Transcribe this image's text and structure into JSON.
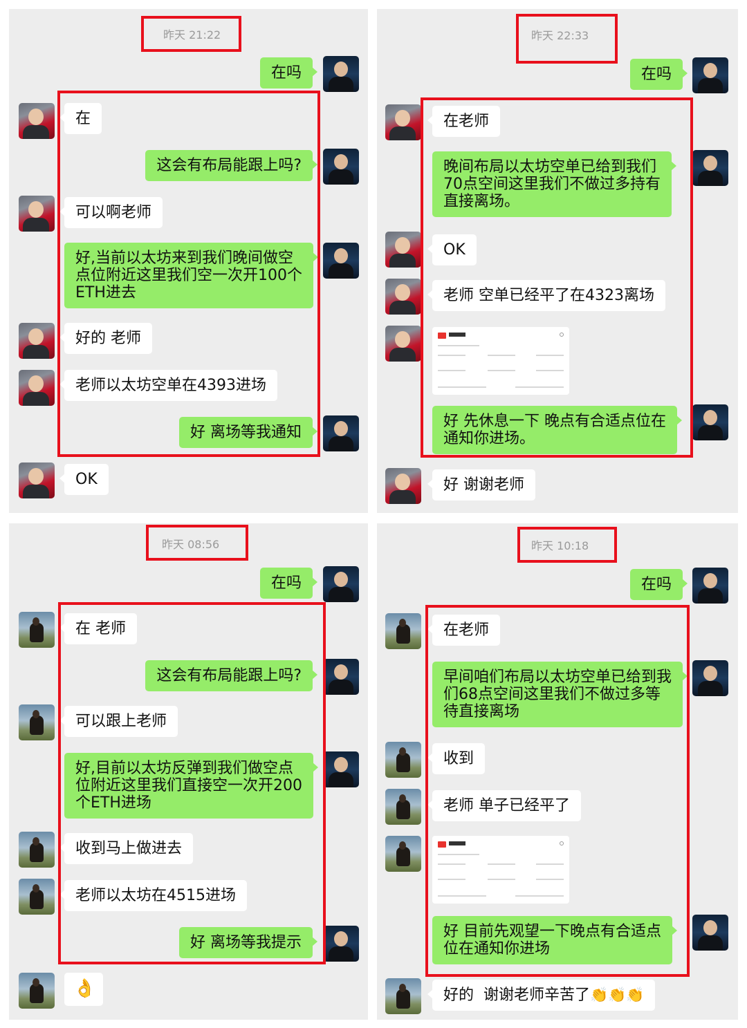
{
  "panels": [
    {
      "timestamp": "昨天 21:22",
      "messages": [
        "在吗",
        "在",
        "这会有布局能跟上吗?",
        "可以啊老师",
        "好,当前以太坊来到我们晚间做空\n点位附近这里我们空一次开100个\nETH进去",
        "好的 老师",
        "老师以太坊空单在4393进场",
        "好 离场等我通知",
        "OK"
      ]
    },
    {
      "timestamp": "昨天 22:33",
      "messages": [
        "在吗",
        "在老师",
        "晚间布局以太坊空单已给到我们\n70点空间这里我们不做过多持有\n直接离场。",
        "OK",
        "老师 空单已经平了在4323离场",
        "好 先休息一下 晚点有合适点位在\n通知你进场。",
        "好 谢谢老师"
      ]
    },
    {
      "timestamp": "昨天 08:56",
      "messages": [
        "在吗",
        "在 老师",
        "这会有布局能跟上吗?",
        "可以跟上老师",
        "好,目前以太坊反弹到我们做空点\n位附近这里我们直接空一次开200\n个ETH进场",
        "收到马上做进去",
        "老师以太坊在4515进场",
        "好 离场等我提示"
      ]
    },
    {
      "timestamp": "昨天 10:18",
      "messages": [
        "在吗",
        "在老师",
        "早间咱们布局以太坊空单已给到我\n们68点空间这里我们不做过多等\n待直接离场",
        "收到",
        "老师 单子已经平了",
        "好 目前先观望一下晚点有合适点\n位在通知你进场",
        "好的  谢谢老师辛苦了"
      ]
    }
  ],
  "icons": {
    "ok_hand": "ok-hand-emoji",
    "clap": "clapping-hands-emoji"
  }
}
